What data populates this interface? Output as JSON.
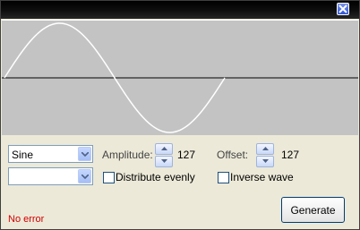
{
  "window": {
    "close_icon": "close-icon",
    "accent": "#2d53d6"
  },
  "preview": {
    "background": "#c3c3c3",
    "wave_color": "#ffffff",
    "axis_color": "#000000"
  },
  "waveform": {
    "selected": "Sine"
  },
  "second_select": {
    "selected": ""
  },
  "amplitude": {
    "label": "Amplitude:",
    "value": "127"
  },
  "offset": {
    "label": "Offset:",
    "value": "127"
  },
  "distribute": {
    "label": "Distribute evenly",
    "checked": false
  },
  "inverse": {
    "label": "Inverse wave",
    "checked": false
  },
  "generate": {
    "label": "Generate"
  },
  "status": {
    "text": "No error",
    "color": "#d00000"
  }
}
